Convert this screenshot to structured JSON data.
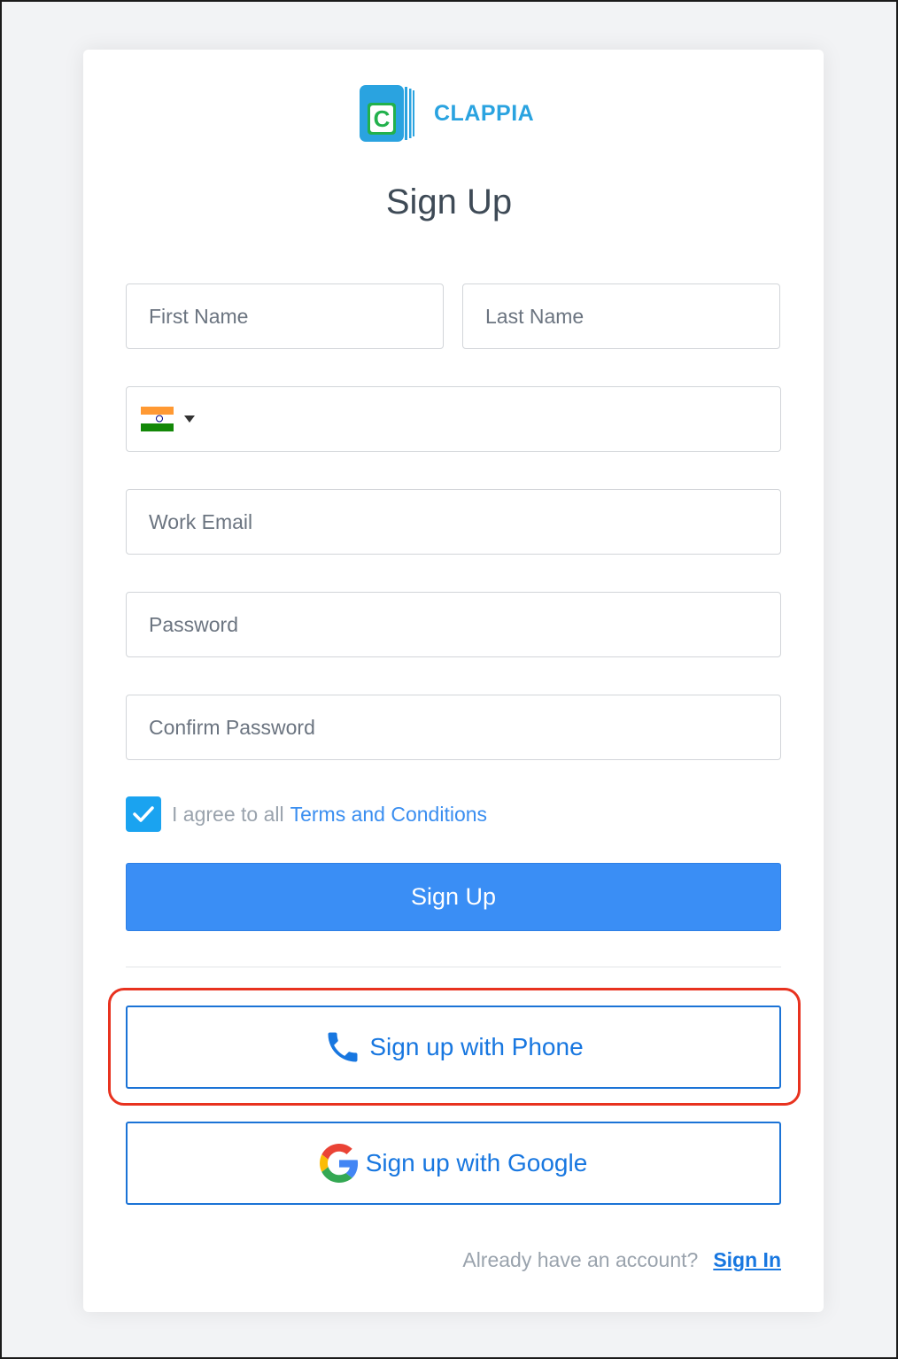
{
  "brand": {
    "name": "CLAPPIA",
    "logo_letter": "C",
    "color": "#2aa3e0"
  },
  "page_title": "Sign Up",
  "form": {
    "first_name_placeholder": "First Name",
    "last_name_placeholder": "Last Name",
    "phone_country": "India",
    "phone_flag_icon": "india-flag-icon",
    "work_email_placeholder": "Work Email",
    "password_placeholder": "Password",
    "confirm_password_placeholder": "Confirm Password",
    "agree_checked": true,
    "agree_text": "I agree to all",
    "terms_link": "Terms and Conditions",
    "submit_label": "Sign Up"
  },
  "alt_signup": {
    "phone_label": "Sign up with Phone",
    "phone_icon": "phone-icon",
    "google_label": "Sign up with Google",
    "google_icon": "google-icon"
  },
  "footer": {
    "prompt": "Already have an account?",
    "signin_link": "Sign In"
  },
  "colors": {
    "primary": "#3a8ef5",
    "link": "#1877e0",
    "checkbox": "#1aa3f0",
    "highlight": "#e8321f"
  }
}
